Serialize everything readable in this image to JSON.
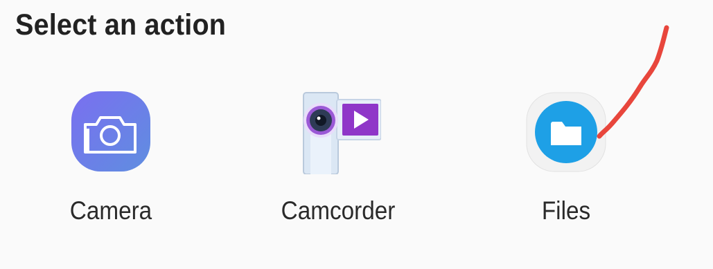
{
  "dialog": {
    "title": "Select an action"
  },
  "actions": [
    {
      "label": "Camera",
      "icon": "camera-icon"
    },
    {
      "label": "Camcorder",
      "icon": "camcorder-icon"
    },
    {
      "label": "Files",
      "icon": "folder-icon"
    }
  ],
  "colors": {
    "camera_icon_gradient": [
      "#6b7fe8",
      "#9a7fe0"
    ],
    "files_icon_blue": "#1ea0e6",
    "camcorder_play": "#8f36c8",
    "annotation": "#e8463c"
  }
}
